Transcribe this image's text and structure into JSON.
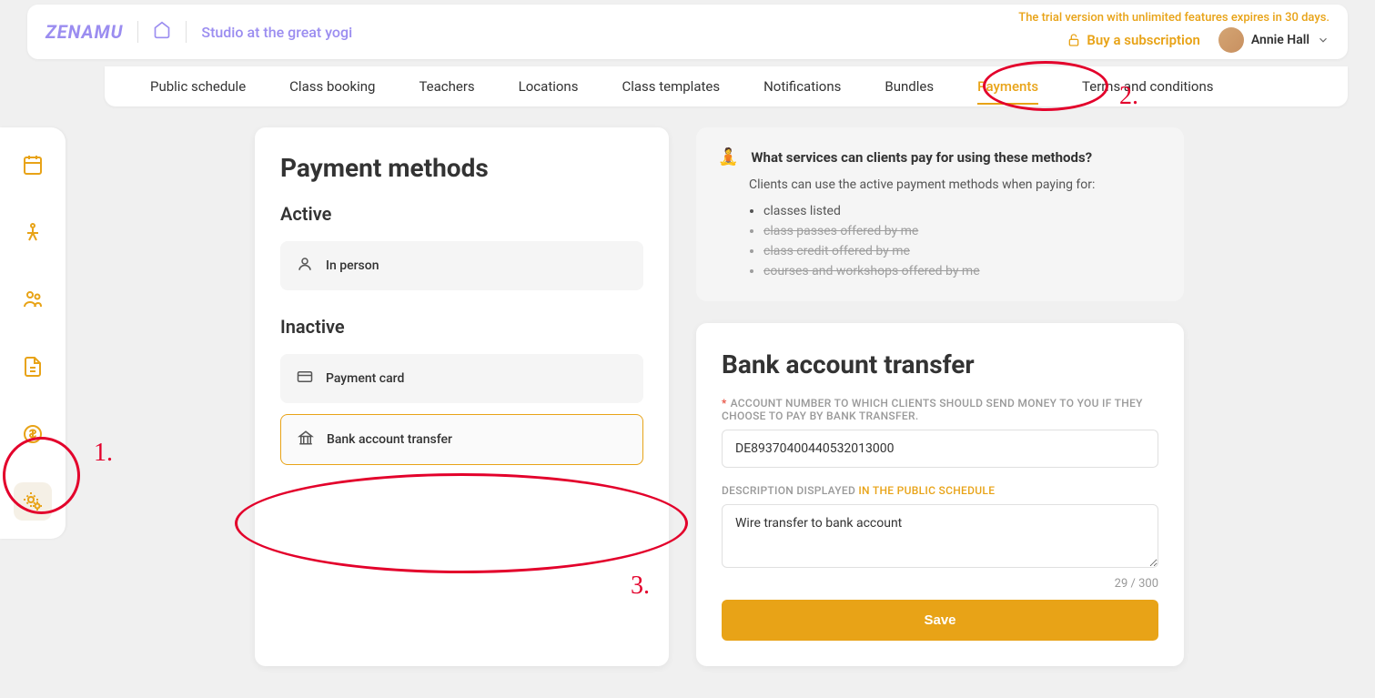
{
  "header": {
    "logo": "ZENAMU",
    "studio_name": "Studio at the great yogi",
    "trial_text": "The trial version with unlimited features expires in 30 days.",
    "buy_sub": "Buy a subscription",
    "user_name": "Annie Hall"
  },
  "nav": {
    "items": [
      {
        "label": "Public schedule",
        "active": false
      },
      {
        "label": "Class booking",
        "active": false
      },
      {
        "label": "Teachers",
        "active": false
      },
      {
        "label": "Locations",
        "active": false
      },
      {
        "label": "Class templates",
        "active": false
      },
      {
        "label": "Notifications",
        "active": false
      },
      {
        "label": "Bundles",
        "active": false
      },
      {
        "label": "Payments",
        "active": true
      },
      {
        "label": "Terms and conditions",
        "active": false
      }
    ]
  },
  "sidebar_icons": [
    "calendar-icon",
    "yoga-icon",
    "people-icon",
    "invoice-icon",
    "dollar-icon",
    "gear-icon"
  ],
  "payment_methods": {
    "title": "Payment methods",
    "active_title": "Active",
    "inactive_title": "Inactive",
    "in_person": "In person",
    "payment_card": "Payment card",
    "bank_transfer": "Bank account transfer"
  },
  "info_box": {
    "title": "What services can clients pay for using these methods?",
    "subtitle": "Clients can use the active payment methods when paying for:",
    "items": [
      {
        "text": "classes listed",
        "strike": false
      },
      {
        "text": "class passes offered by me",
        "strike": true
      },
      {
        "text": "class credit offered by me",
        "strike": true
      },
      {
        "text": "courses and workshops offered by me",
        "strike": true
      }
    ]
  },
  "form": {
    "title": "Bank account transfer",
    "account_label": "ACCOUNT NUMBER TO WHICH CLIENTS SHOULD SEND MONEY TO YOU IF THEY CHOOSE TO PAY BY BANK TRANSFER.",
    "account_value": "DE89370400440532013000",
    "desc_label_pre": "DESCRIPTION DISPLAYED ",
    "desc_label_link": "IN THE PUBLIC SCHEDULE",
    "desc_value": "Wire transfer to bank account",
    "char_count": "29 / 300",
    "save": "Save"
  },
  "annotations": {
    "n1": "1.",
    "n2": "2.",
    "n3": "3."
  }
}
